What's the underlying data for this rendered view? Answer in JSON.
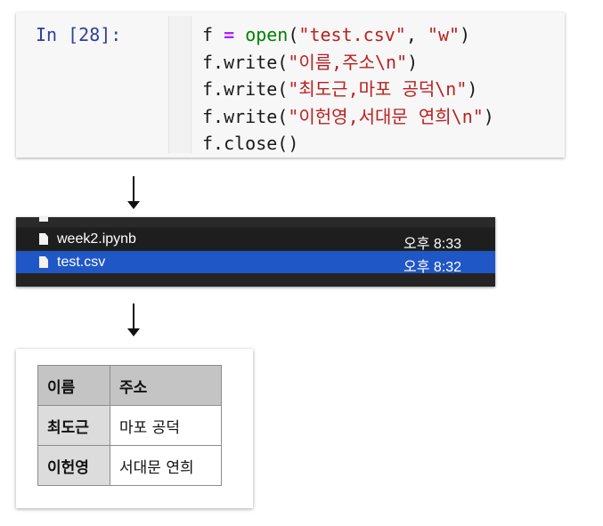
{
  "notebook_cell": {
    "prompt": "In [28]:",
    "lines": [
      [
        {
          "t": "f ",
          "c": ""
        },
        {
          "t": "=",
          "c": "op"
        },
        {
          "t": " ",
          "c": ""
        },
        {
          "t": "open",
          "c": "bi"
        },
        {
          "t": "(",
          "c": ""
        },
        {
          "t": "\"test.csv\"",
          "c": "str"
        },
        {
          "t": ", ",
          "c": ""
        },
        {
          "t": "\"w\"",
          "c": "str"
        },
        {
          "t": ")",
          "c": ""
        }
      ],
      [
        {
          "t": "f.write(",
          "c": ""
        },
        {
          "t": "\"이름,주소",
          "c": "str"
        },
        {
          "t": "\\n",
          "c": "esc"
        },
        {
          "t": "\"",
          "c": "str"
        },
        {
          "t": ")",
          "c": ""
        }
      ],
      [
        {
          "t": "f.write(",
          "c": ""
        },
        {
          "t": "\"최도근,마포 공덕",
          "c": "str"
        },
        {
          "t": "\\n",
          "c": "esc"
        },
        {
          "t": "\"",
          "c": "str"
        },
        {
          "t": ")",
          "c": ""
        }
      ],
      [
        {
          "t": "f.write(",
          "c": ""
        },
        {
          "t": "\"이헌영,서대문 연희",
          "c": "str"
        },
        {
          "t": "\\n",
          "c": "esc"
        },
        {
          "t": "\"",
          "c": "str"
        },
        {
          "t": ")",
          "c": ""
        }
      ],
      [
        {
          "t": "f.close()",
          "c": ""
        }
      ]
    ]
  },
  "file_list": {
    "rows": [
      {
        "name": "week2.ipynb",
        "time": "오후 8:33",
        "selected": false
      },
      {
        "name": "test.csv",
        "time": "오후 8:32",
        "selected": true
      }
    ]
  },
  "csv_table": {
    "header": [
      "이름",
      "주소"
    ],
    "rows": [
      [
        "최도근",
        "마포 공덕"
      ],
      [
        "이헌영",
        "서대문 연희"
      ]
    ]
  },
  "colors": {
    "prompt": "#303f9f",
    "string": "#ba2121",
    "builtin": "#008000",
    "operator": "#aa22ff",
    "selection": "#2057c6",
    "finder_bg": "#242424",
    "table_header": "#c4c4c4"
  },
  "icons": [
    "file-icon",
    "down-arrow-icon"
  ]
}
